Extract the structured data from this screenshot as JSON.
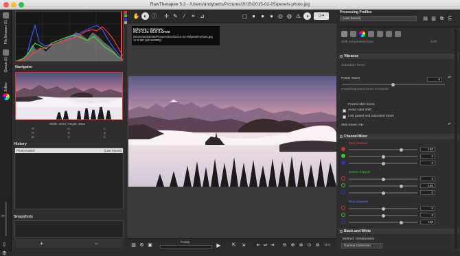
{
  "window": {
    "title": "RawTherapee 5.3 - /Users/andybetts/Pictures/2015/2015-02-05/pexels-photo.jpg"
  },
  "left_tabs": [
    {
      "label": "File Browser (1)",
      "icon": "folder-icon"
    },
    {
      "label": "Queue (1)",
      "icon": "queue-icon"
    },
    {
      "label": "Editor",
      "icon": "color-wheel-icon"
    }
  ],
  "left_bottom": {
    "percent": "0%"
  },
  "navigator": {
    "title": "Navigator",
    "size_text": "Width: 6012, Height: 3602",
    "readouts": [
      "R:",
      "G:",
      "B:",
      "H:",
      "S:",
      "V:",
      "L:",
      "a:",
      "b:"
    ]
  },
  "history": {
    "title": "History",
    "rows": [
      {
        "action": "Photo loaded",
        "value": "(Last Saved)"
      }
    ]
  },
  "snapshots": {
    "title": "Snapshots",
    "add_label": "+",
    "remove_label": "−"
  },
  "overlay": {
    "line1": "Unknown + Unknown",
    "line2": "f/0.0  0.0s  f/0.0  0.0mm",
    "line3": "/Users/andybetts/Pictures/2015/2015-02-05/pexels-photo.jpg",
    "line4": "17.8 MP (6012x3602)"
  },
  "status": {
    "text": "Ready",
    "zoom": "11%"
  },
  "right": {
    "processing_profiles": "Processing Profiles",
    "profile_value": "(Last Saved)",
    "vibrance_header": "Vibrance",
    "saturated_tones": "Saturated Tones",
    "pastel_tones": "Pastel Tones",
    "pastel_value": "0",
    "pastel_threshold": "Pastel/saturated tones threshold",
    "protect_skin": "Protect skin-tones",
    "avoid_color_shift": "Avoid color shift",
    "link_pastel": "Link pastel and saturated tones",
    "skin_tones": "Skin-tones: HH",
    "channel_mixer": "Channel Mixer",
    "red_channel": "Red channel",
    "green_channel": "Green channel",
    "blue_channel": "Blue channel",
    "channel_values": [
      [
        "100",
        "0",
        "0"
      ],
      [
        "0",
        "100",
        "0"
      ],
      [
        "0",
        "0",
        "100"
      ]
    ],
    "bw_header": "Black-and-White",
    "method_label": "Method:",
    "method_value": "Desaturation",
    "gamma_label": "Gamma Correction",
    "wb_hint": "Shift temperature bias",
    "wb_value": "0.00"
  },
  "colors": {
    "accent": "#e04040",
    "panel": "#2e2e2e",
    "dark": "#1f1f1f"
  }
}
